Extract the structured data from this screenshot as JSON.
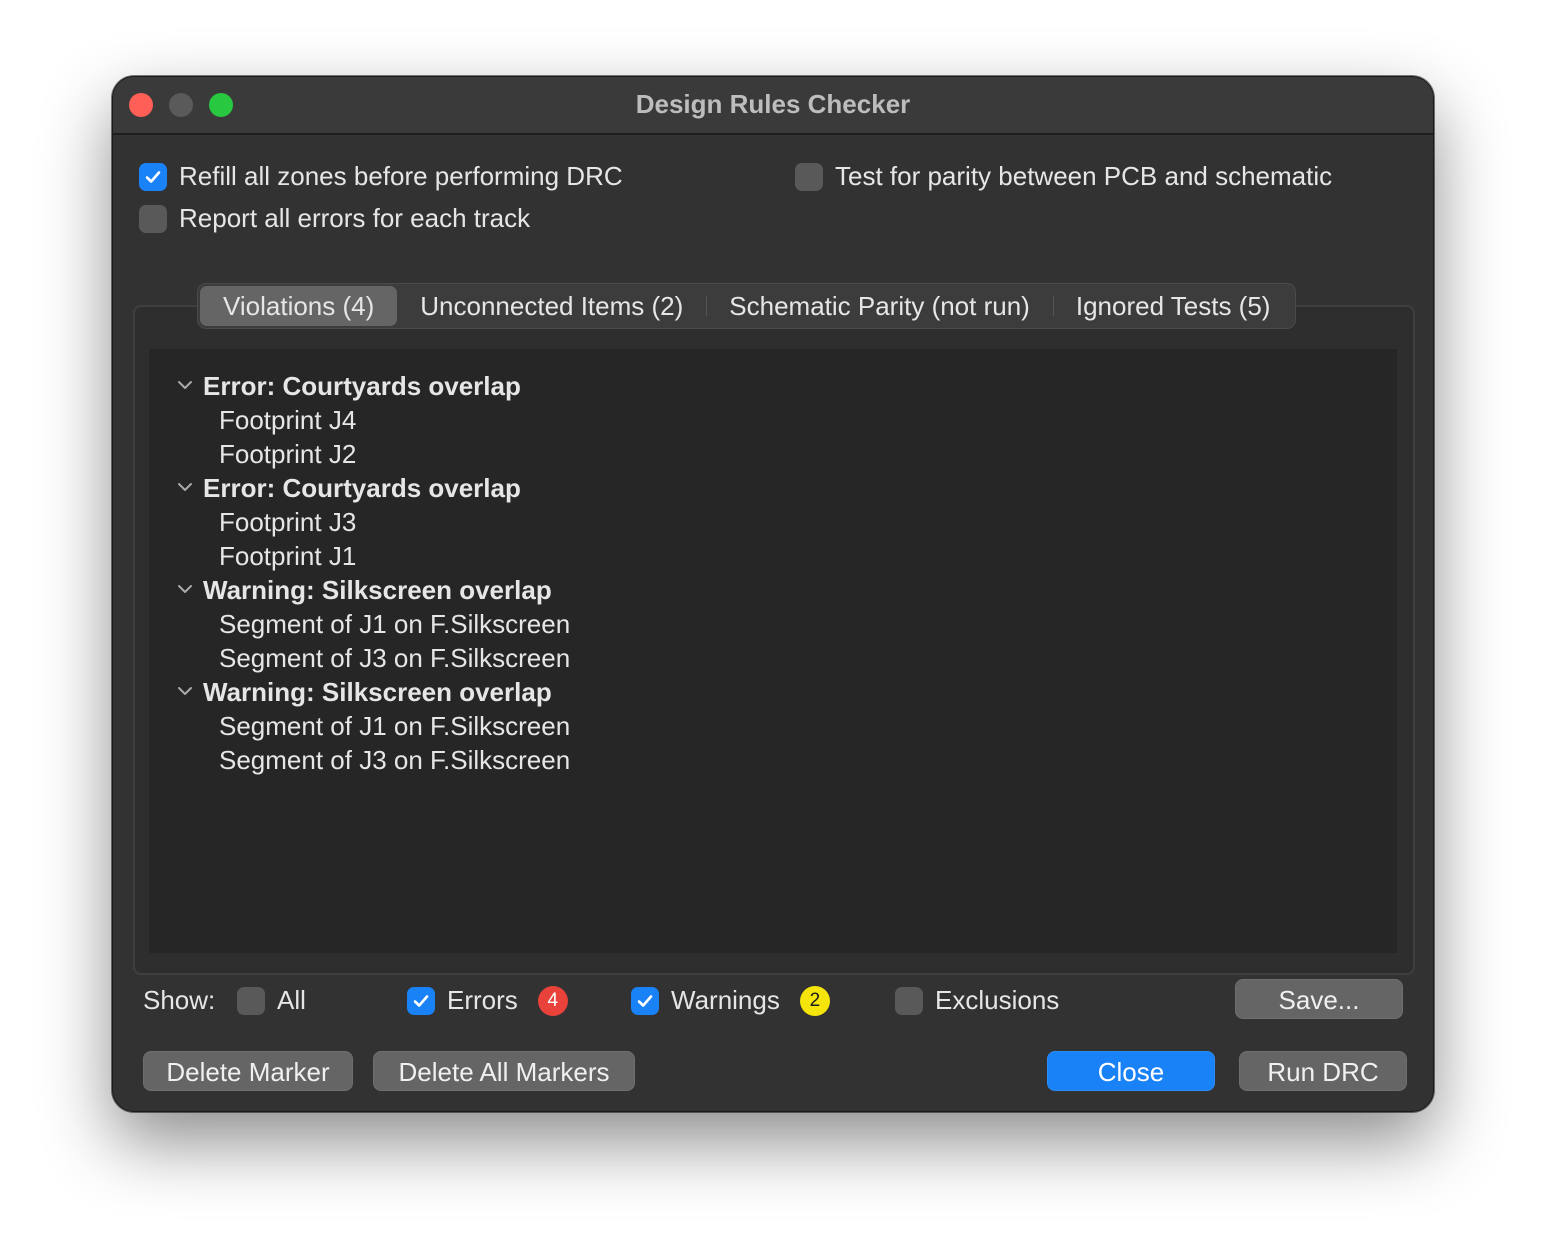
{
  "window": {
    "title": "Design Rules Checker"
  },
  "options": {
    "refill_zones": {
      "label": "Refill all zones before performing DRC",
      "checked": true
    },
    "report_all_errors": {
      "label": "Report all errors for each track",
      "checked": false
    },
    "test_parity": {
      "label": "Test for parity between PCB and schematic",
      "checked": false
    }
  },
  "tabs": [
    {
      "label": "Violations (4)",
      "active": true
    },
    {
      "label": "Unconnected Items (2)",
      "active": false
    },
    {
      "label": "Schematic Parity (not run)",
      "active": false
    },
    {
      "label": "Ignored Tests (5)",
      "active": false
    }
  ],
  "violations": [
    {
      "title": "Error: Courtyards overlap",
      "items": [
        "Footprint J4",
        "Footprint J2"
      ]
    },
    {
      "title": "Error: Courtyards overlap",
      "items": [
        "Footprint J3",
        "Footprint J1"
      ]
    },
    {
      "title": "Warning: Silkscreen overlap",
      "items": [
        "Segment of J1 on F.Silkscreen",
        "Segment of J3 on F.Silkscreen"
      ]
    },
    {
      "title": "Warning: Silkscreen overlap",
      "items": [
        "Segment of J1 on F.Silkscreen",
        "Segment of J3 on F.Silkscreen"
      ]
    }
  ],
  "filters": {
    "show_label": "Show:",
    "all": {
      "label": "All",
      "checked": false
    },
    "errors": {
      "label": "Errors",
      "checked": true,
      "count": "4"
    },
    "warnings": {
      "label": "Warnings",
      "checked": true,
      "count": "2"
    },
    "exclusions": {
      "label": "Exclusions",
      "checked": false
    }
  },
  "buttons": {
    "save": "Save...",
    "delete_marker": "Delete Marker",
    "delete_all_markers": "Delete All Markers",
    "close": "Close",
    "run_drc": "Run DRC"
  },
  "colors": {
    "accent": "#1a82f7",
    "error_badge": "#e8423b",
    "warning_badge": "#f5e50a",
    "traffic_close": "#ff5f57",
    "traffic_max": "#28c840"
  },
  "icons": [
    "check-icon",
    "chevron-down-icon"
  ]
}
